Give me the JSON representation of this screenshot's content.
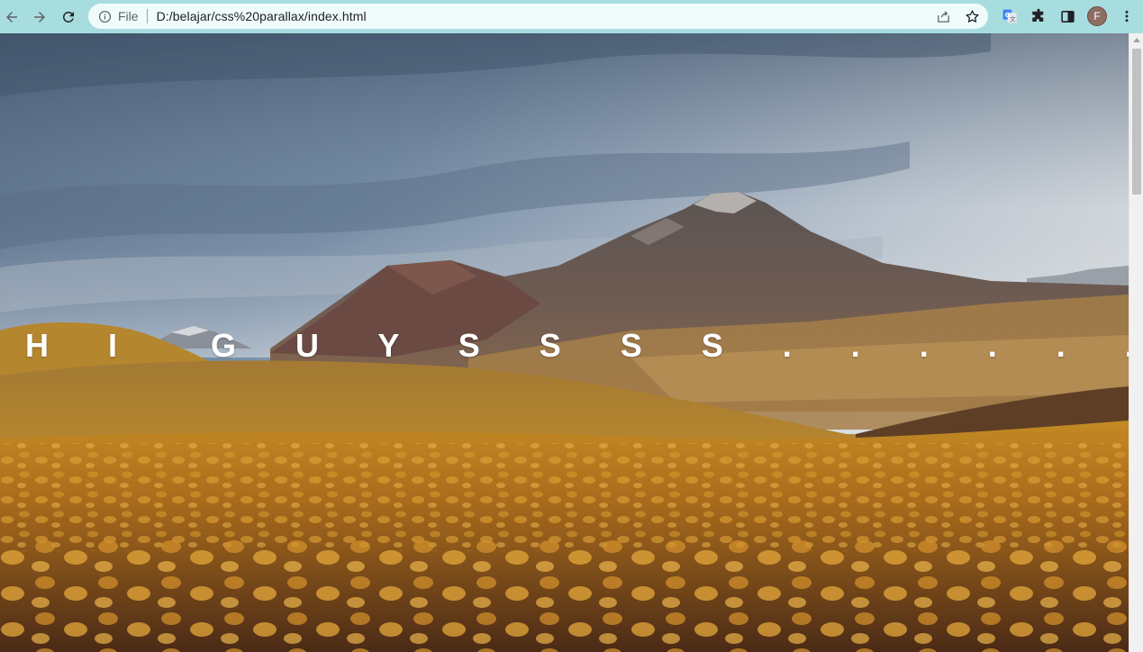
{
  "browser": {
    "scheme_label": "File",
    "url": "D:/belajar/css%20parallax/index.html",
    "profile_initial": "F",
    "icons": {
      "back": "arrow-left-icon",
      "forward": "arrow-right-icon",
      "reload": "reload-icon",
      "info": "info-icon",
      "share": "share-icon",
      "bookmark": "star-icon",
      "translate": "google-translate-icon",
      "extensions": "puzzle-icon",
      "side_panel": "side-panel-icon",
      "menu": "kebab-menu-icon"
    },
    "colors": {
      "toolbar": "#a8dde0",
      "omnibox": "#f0fbfb",
      "avatar": "#8d6e63"
    }
  },
  "page": {
    "headline": "H I  G U Y S S S S . . . . . . . .",
    "background": "mountain-desert-landscape-photo"
  }
}
